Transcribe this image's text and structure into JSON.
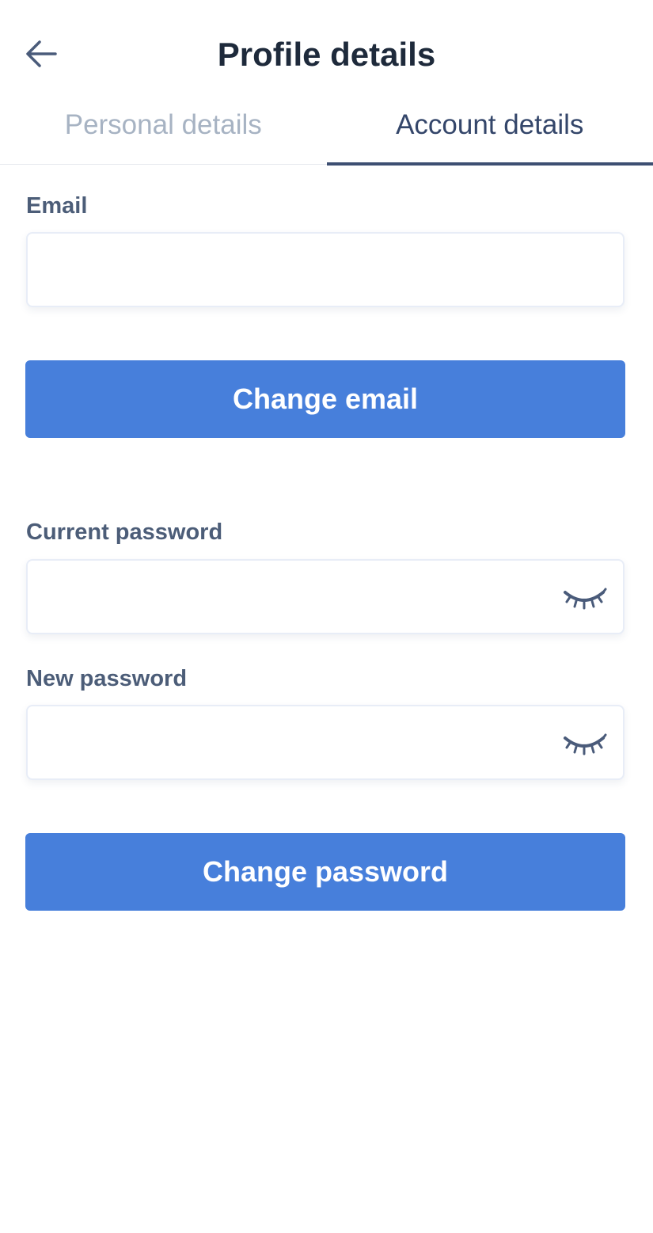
{
  "header": {
    "title": "Profile details",
    "back_icon": "arrow-left-icon"
  },
  "tabs": [
    {
      "label": "Personal details",
      "active": false
    },
    {
      "label": "Account details",
      "active": true
    }
  ],
  "email_section": {
    "label": "Email",
    "value": "",
    "button_label": "Change email"
  },
  "password_section": {
    "current_label": "Current password",
    "current_value": "",
    "new_label": "New password",
    "new_value": "",
    "toggle_icon": "eye-closed-icon",
    "button_label": "Change password"
  },
  "colors": {
    "primary": "#477fdb",
    "title": "#1e2a3b",
    "label": "#4c5d78",
    "tab_inactive": "#a7b3c3",
    "tab_active": "#34466a"
  }
}
